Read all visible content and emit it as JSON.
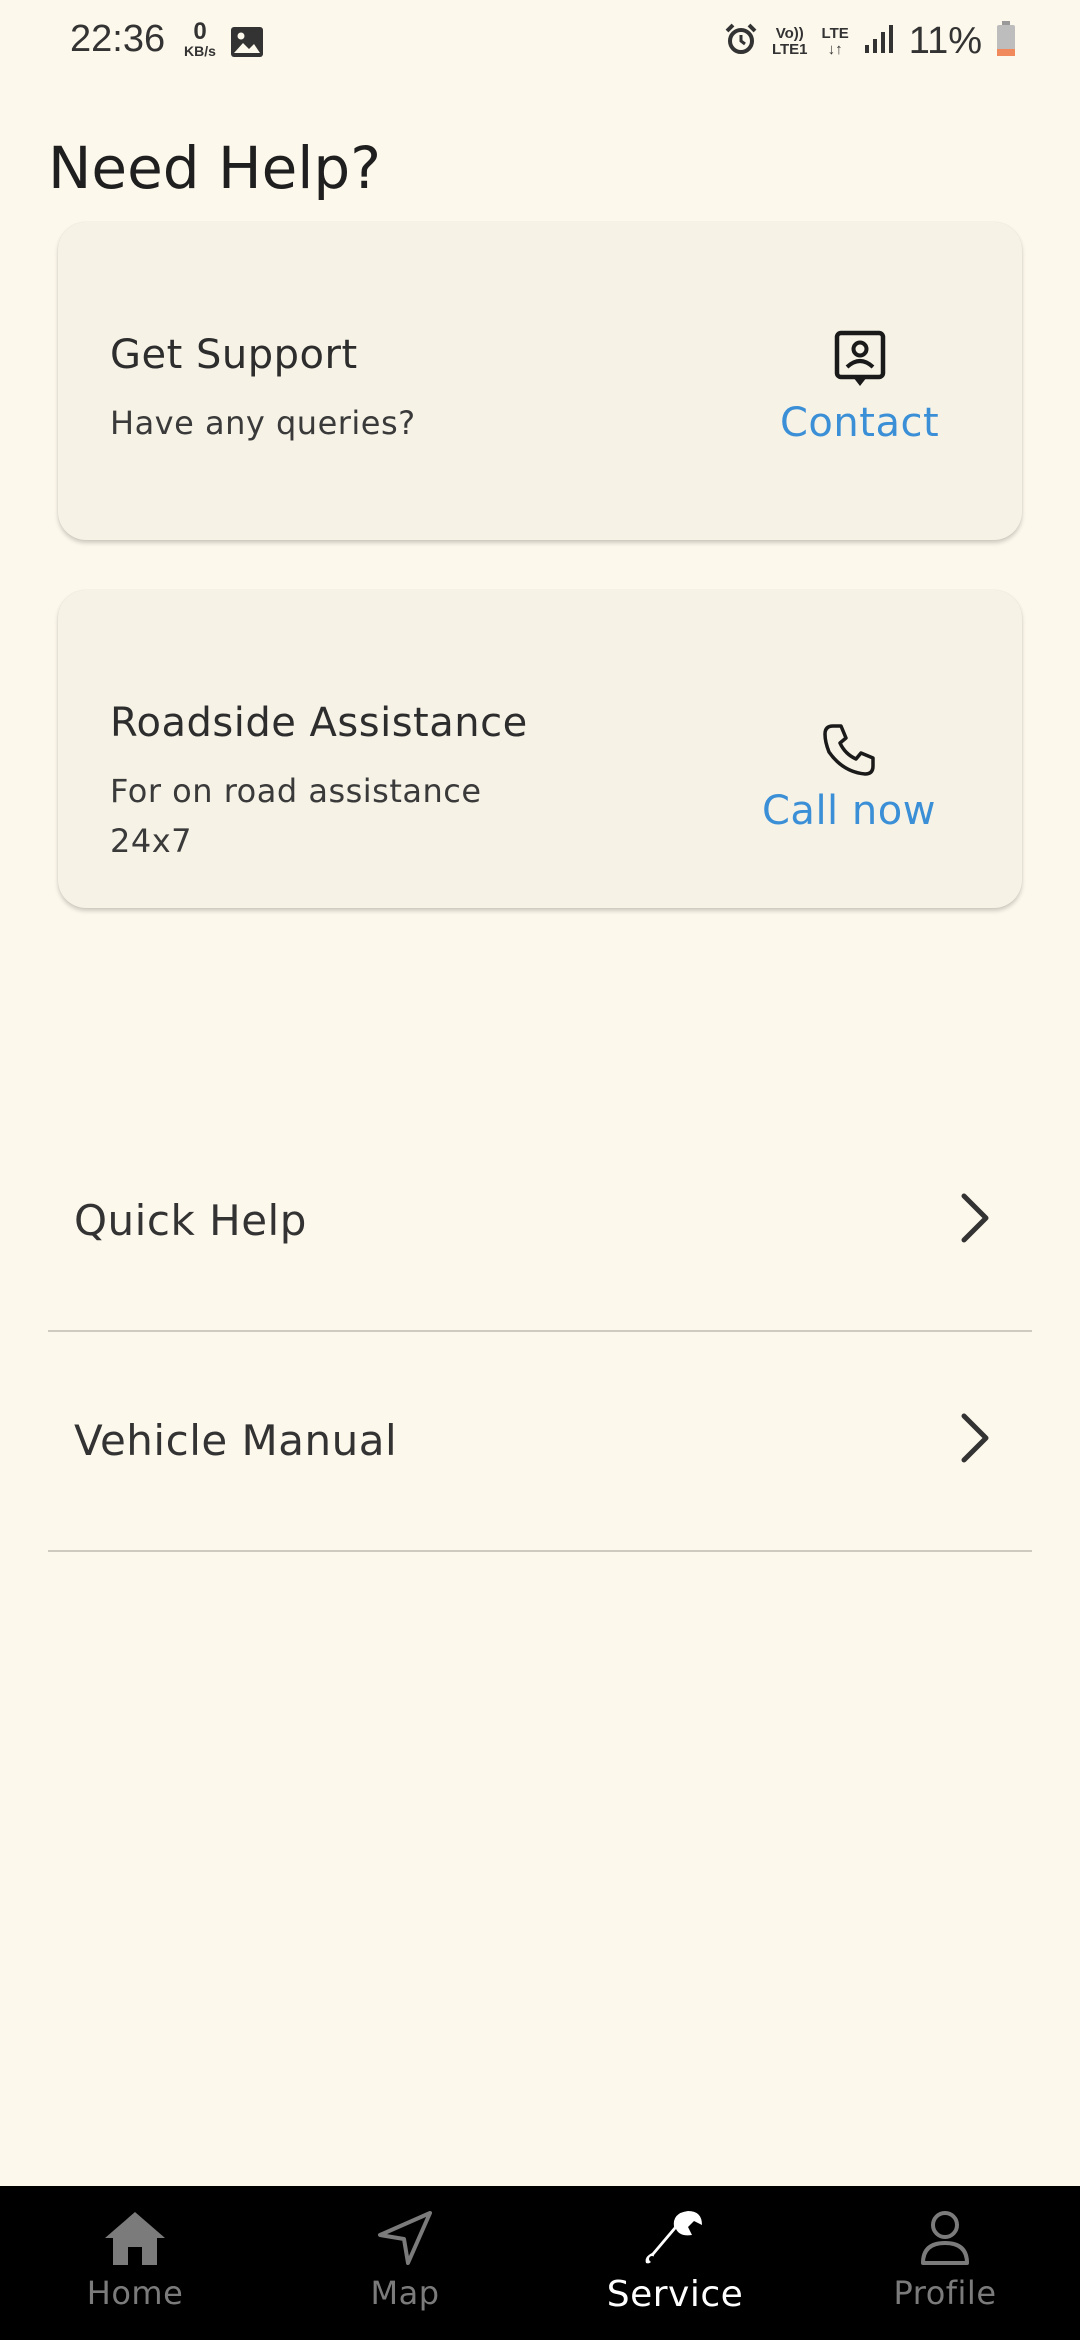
{
  "status_bar": {
    "time": "22:36",
    "speed_value": "0",
    "speed_unit": "KB/s",
    "volte_top": "Vo))",
    "volte_bottom": "LTE1",
    "lte_top": "LTE",
    "lte_bottom": "↓↑",
    "battery_text": "11%",
    "icons": [
      "gallery-icon",
      "alarm-icon",
      "signal-icon",
      "battery-icon"
    ]
  },
  "page": {
    "title": "Need Help?"
  },
  "cards": {
    "support": {
      "title": "Get Support",
      "subtitle": "Have any queries?",
      "action_label": "Contact",
      "action_icon": "contact-card-icon"
    },
    "roadside": {
      "title": "Roadside Assistance",
      "subtitle_line1": "For on road assistance",
      "subtitle_line2": "24x7",
      "action_label": "Call now",
      "action_icon": "phone-icon"
    }
  },
  "list": {
    "items": [
      {
        "label": "Quick Help",
        "icon": "chevron-right-icon"
      },
      {
        "label": "Vehicle Manual",
        "icon": "chevron-right-icon"
      }
    ]
  },
  "bottom_nav": {
    "items": [
      {
        "label": "Home",
        "icon": "home-icon",
        "active": false
      },
      {
        "label": "Map",
        "icon": "navigation-arrow-icon",
        "active": false
      },
      {
        "label": "Service",
        "icon": "wrench-icon",
        "active": true
      },
      {
        "label": "Profile",
        "icon": "person-icon",
        "active": false
      }
    ]
  },
  "colors": {
    "background": "#fdf8ec",
    "card": "#f6f2e6",
    "accent": "#3a8fd6",
    "nav_background": "#000000",
    "nav_active": "#ffffff",
    "nav_inactive": "#7b7b7b",
    "battery_low": "#f08a5d"
  }
}
